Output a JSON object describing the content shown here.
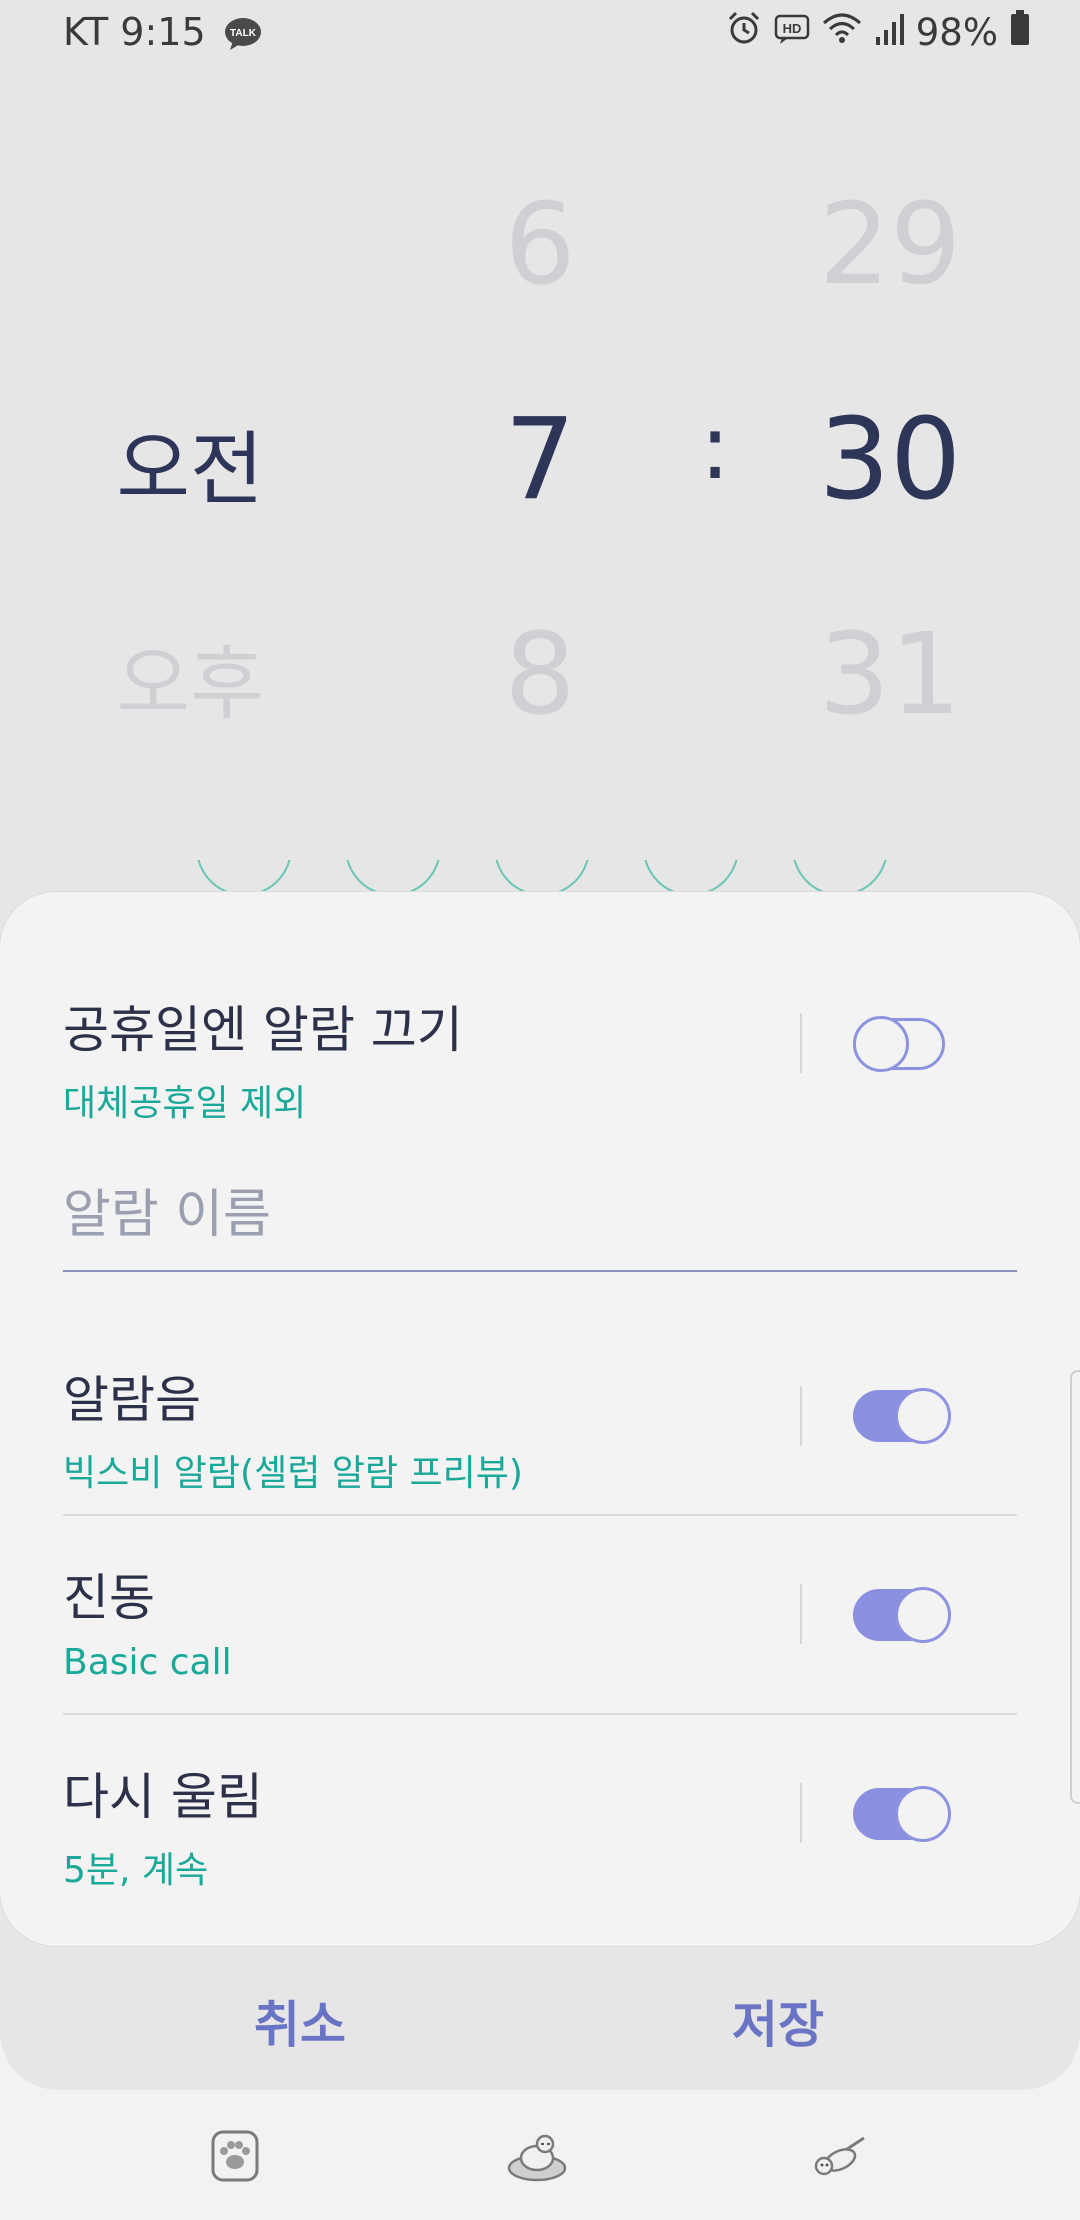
{
  "status_bar": {
    "carrier": "KT",
    "time": "9:15",
    "talk_badge": "TALK",
    "hd_badge": "HD",
    "battery": "98%"
  },
  "picker": {
    "ampm_prev": "",
    "ampm_selected": "오전",
    "ampm_next": "오후",
    "hour_prev": "6",
    "hour_selected": "7",
    "hour_next": "8",
    "separator": ":",
    "minute_prev": "29",
    "minute_selected": "30",
    "minute_next": "31"
  },
  "settings": {
    "holiday": {
      "title": "공휴일엔 알람 끄기",
      "subtitle": "대체공휴일 제외",
      "enabled": false
    },
    "alarm_name": {
      "placeholder": "알람 이름",
      "value": ""
    },
    "sound": {
      "title": "알람음",
      "subtitle": "빅스비 알람(셀럽 알람 프리뷰)",
      "enabled": true
    },
    "vibration": {
      "title": "진동",
      "subtitle": "Basic call",
      "enabled": true
    },
    "snooze": {
      "title": "다시 울림",
      "subtitle": "5분, 계속",
      "enabled": true
    }
  },
  "actions": {
    "cancel": "취소",
    "save": "저장"
  },
  "bottom_nav": [
    {
      "icon": "paw-icon"
    },
    {
      "icon": "sleeping-dog-icon"
    },
    {
      "icon": "flying-dog-icon"
    }
  ],
  "colors": {
    "accent": "#8b8fe0",
    "subtitle": "#1aa899",
    "title": "#2c3149",
    "action": "#6a74c4"
  }
}
